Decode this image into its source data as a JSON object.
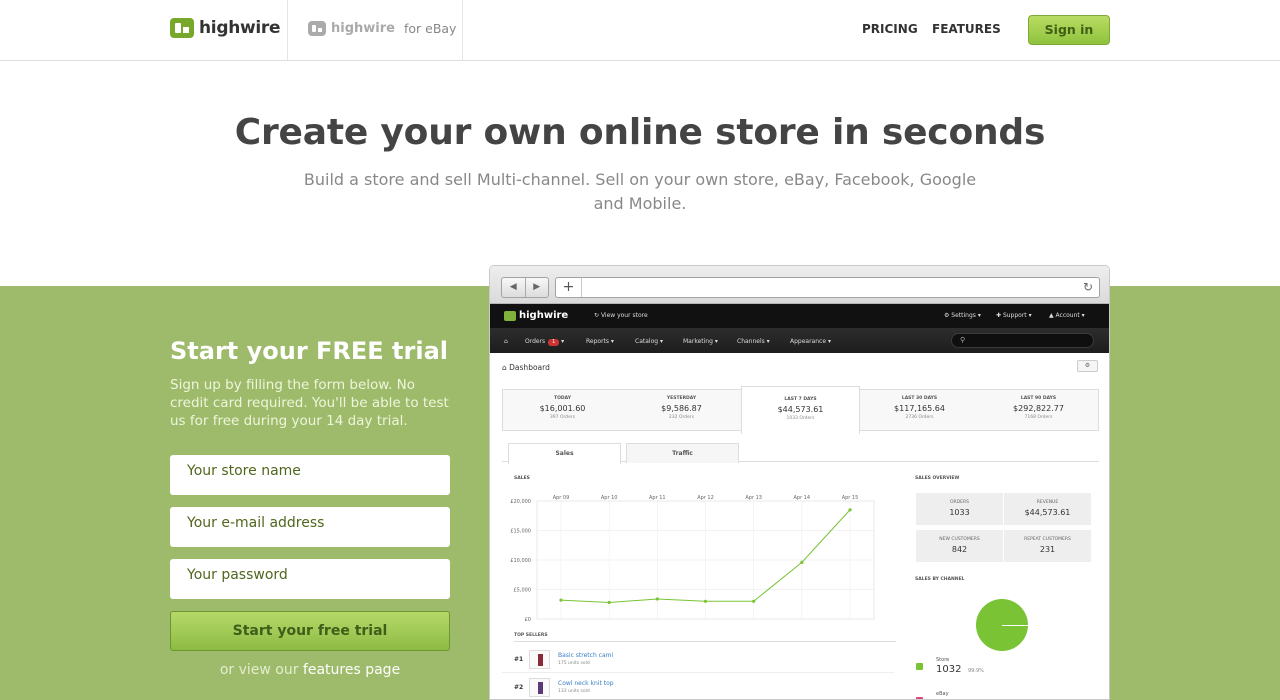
{
  "header": {
    "brand": "highwire",
    "ebay_brand": "highwire",
    "ebay_suffix": "for eBay",
    "nav": [
      "PRICING",
      "FEATURES"
    ],
    "signin_label": "Sign in"
  },
  "hero": {
    "title": "Create your own online store in seconds",
    "subtitle": "Build a store and sell Multi-channel. Sell on your own store, eBay, Facebook, Google and Mobile."
  },
  "trial": {
    "title": "Start your FREE trial",
    "description": "Sign up by filling the form below. No credit card required. You'll be able to test us for free during your 14 day trial.",
    "fields": [
      "Your store name",
      "Your e-mail address",
      "Your password"
    ],
    "cta_label": "Start your free trial",
    "alt_prefix": "or view our",
    "alt_link": "features page"
  },
  "screenshot": {
    "app_brand": "highwire",
    "view_store": "View your store",
    "top_menu": [
      "Settings",
      "Support",
      "Account"
    ],
    "menu": [
      "Orders",
      "Reports",
      "Catalog",
      "Marketing",
      "Channels",
      "Appearance"
    ],
    "orders_badge": "1",
    "page_title": "Dashboard",
    "stats": [
      {
        "label": "TODAY",
        "value": "$16,001.60",
        "orders": "397 Orders"
      },
      {
        "label": "YESTERDAY",
        "value": "$9,586.87",
        "orders": "232 Orders"
      },
      {
        "label": "LAST 7 DAYS",
        "value": "$44,573.61",
        "orders": "1033 Orders"
      },
      {
        "label": "LAST 30 DAYS",
        "value": "$117,165.64",
        "orders": "2736 Orders"
      },
      {
        "label": "LAST 90 DAYS",
        "value": "$292,822.77",
        "orders": "7168 Orders"
      }
    ],
    "tabs": [
      "Sales",
      "Traffic"
    ],
    "sales_heading": "SALES",
    "overview_heading": "SALES OVERVIEW",
    "overview": [
      {
        "label": "ORDERS",
        "value": "1033"
      },
      {
        "label": "REVENUE",
        "value": "$44,573.61"
      },
      {
        "label": "NEW CUSTOMERS",
        "value": "842"
      },
      {
        "label": "REPEAT CUSTOMERS",
        "value": "231"
      }
    ],
    "channel_heading": "SALES BY CHANNEL",
    "channels": [
      {
        "name": "Store",
        "value": "1032",
        "pct": "99.9%",
        "color": "#79c335"
      },
      {
        "name": "eBay",
        "value": "",
        "pct": "",
        "color": "#e0457b"
      }
    ],
    "top_sellers_heading": "TOP SELLERS",
    "top_sellers": [
      {
        "rank": "#1",
        "name": "Basic stretch cami",
        "units": "175 units sold"
      },
      {
        "rank": "#2",
        "name": "Cowl neck knit top",
        "units": "133 units sold"
      }
    ]
  },
  "chart_data": {
    "type": "line",
    "title": "",
    "categories": [
      "Apr 09",
      "Apr 10",
      "Apr 11",
      "Apr 12",
      "Apr 13",
      "Apr 14",
      "Apr 15"
    ],
    "series": [
      {
        "values": [
          3200,
          2800,
          3400,
          3000,
          3000,
          9600,
          18500
        ]
      }
    ],
    "y_ticks": [
      "£20,000",
      "£15,000",
      "£10,000",
      "£5,000",
      "£0"
    ],
    "ylim": [
      0,
      20000
    ],
    "color": "#79c335"
  }
}
